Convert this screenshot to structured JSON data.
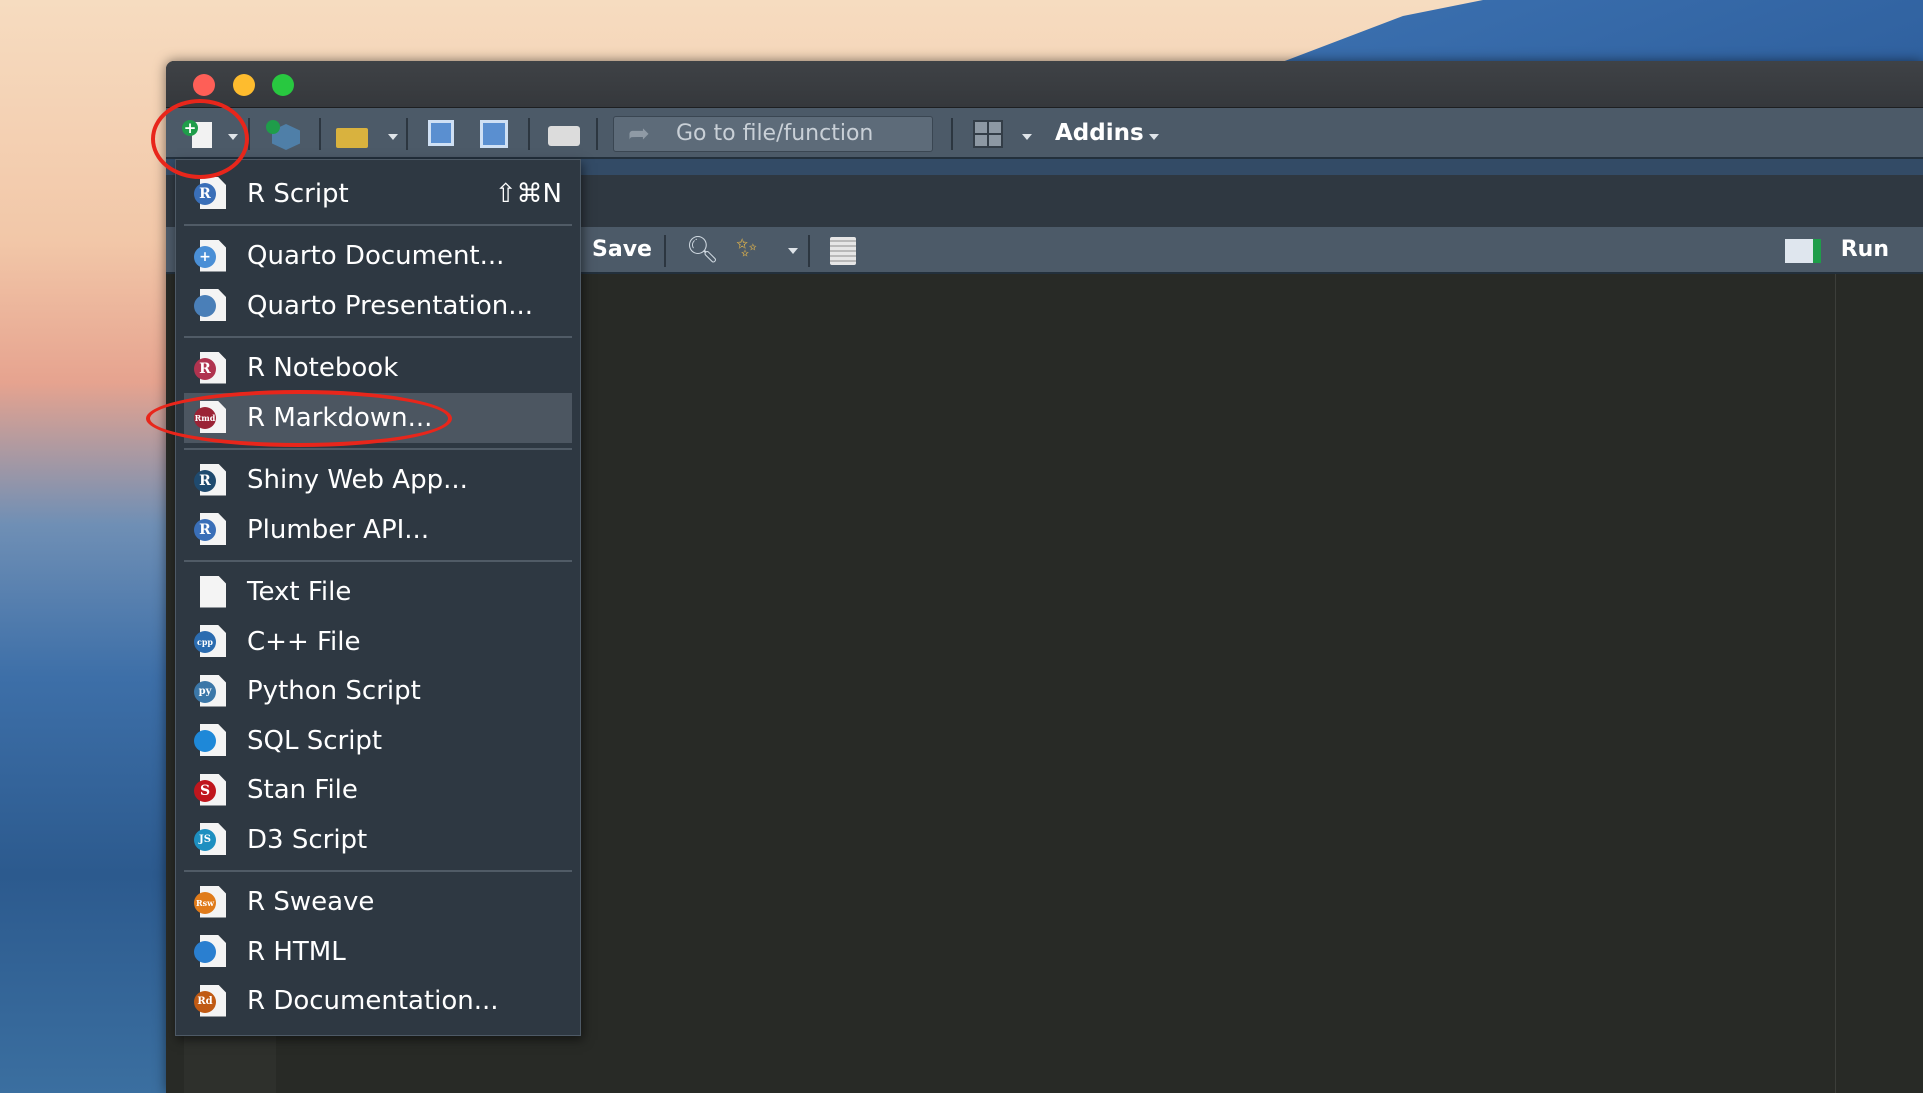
{
  "toolbar": {
    "goto_placeholder": "Go to file/function",
    "addins_label": "Addins"
  },
  "editor_toolbar": {
    "save_label": "Save",
    "run_label": "Run"
  },
  "menu": {
    "items": [
      {
        "label": "R Script",
        "shortcut": "⇧⌘N",
        "icon": "r-script-icon",
        "badge": "R",
        "color": "#3a6fb8"
      },
      {
        "sep": true
      },
      {
        "label": "Quarto Document...",
        "icon": "quarto-document-icon",
        "badge": "+",
        "color": "#4a8fd6"
      },
      {
        "label": "Quarto Presentation...",
        "icon": "quarto-presentation-icon",
        "badge": "",
        "color": "#4a7fb8"
      },
      {
        "sep": true
      },
      {
        "label": "R Notebook",
        "icon": "r-notebook-icon",
        "badge": "R",
        "color": "#b0334f"
      },
      {
        "label": "R Markdown...",
        "icon": "r-markdown-icon",
        "badge": "Rmd",
        "color": "#9b2335",
        "highlighted": true
      },
      {
        "sep": true
      },
      {
        "label": "Shiny Web App...",
        "icon": "shiny-icon",
        "badge": "R",
        "color": "#1f4a6e"
      },
      {
        "label": "Plumber API...",
        "icon": "plumber-icon",
        "badge": "R",
        "color": "#3a6fb8"
      },
      {
        "sep": true
      },
      {
        "label": "Text File",
        "icon": "text-file-icon",
        "badge": "",
        "color": ""
      },
      {
        "label": "C++ File",
        "icon": "cpp-file-icon",
        "badge": "cpp",
        "color": "#2b6cb0"
      },
      {
        "label": "Python Script",
        "icon": "python-icon",
        "badge": "py",
        "color": "#3b77a8"
      },
      {
        "label": "SQL Script",
        "icon": "sql-icon",
        "badge": "",
        "color": "#1e88d8"
      },
      {
        "label": "Stan File",
        "icon": "stan-icon",
        "badge": "S",
        "color": "#c0161d"
      },
      {
        "label": "D3 Script",
        "icon": "d3-script-icon",
        "badge": "JS",
        "color": "#1d8fc0"
      },
      {
        "sep": true
      },
      {
        "label": "R Sweave",
        "icon": "r-sweave-icon",
        "badge": "Rsw",
        "color": "#e07b1a"
      },
      {
        "label": "R HTML",
        "icon": "r-html-icon",
        "badge": "",
        "color": "#2a7fd0"
      },
      {
        "label": "R Documentation...",
        "icon": "r-documentation-icon",
        "badge": "Rd",
        "color": "#c05a14"
      }
    ]
  },
  "colors": {
    "annotation": "#e8261b",
    "menu_bg": "#2e3842",
    "highlight": "#4c5661"
  }
}
